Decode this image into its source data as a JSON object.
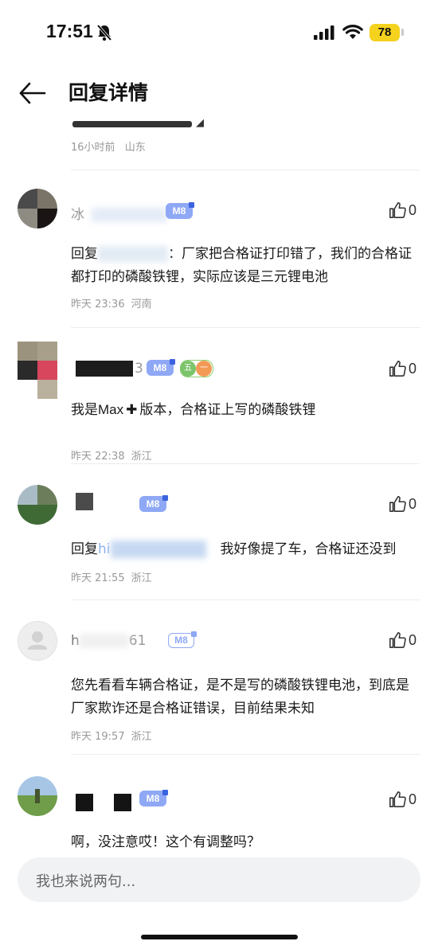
{
  "status_bar": {
    "time": "17:51",
    "battery": "78"
  },
  "header": {
    "title": "回复详情"
  },
  "partial_comment": {
    "time": "16小时前",
    "region": "山东"
  },
  "comments": [
    {
      "name": "冰",
      "badge": "M8",
      "likes": "0",
      "reply_prefix": "回复",
      "text": "：厂家把合格证打印错了，我们的合格证都打印的磷酸铁锂，实际应该是三元锂电池",
      "time": "昨天 23:36",
      "region": "河南"
    },
    {
      "name": "3",
      "badge": "M8",
      "level": "五一",
      "likes": "0",
      "text_a": "我是",
      "text_b": "Max",
      "text_c": "版本，合格证上写的磷酸铁锂",
      "time": "昨天 22:38",
      "region": "浙江"
    },
    {
      "name": "",
      "badge": "M8",
      "likes": "0",
      "reply_prefix": "回复",
      "reply_target": "hi",
      "text": "我好像提了车，合格证还没到",
      "time": "昨天 21:55",
      "region": "浙江"
    },
    {
      "name_a": "h",
      "name_b": "61",
      "badge": "M8",
      "likes": "0",
      "text": "您先看看车辆合格证，是不是写的磷酸铁锂电池，到底是厂家欺诈还是合格证错误，目前结果未知",
      "time": "昨天 19:57",
      "region": "浙江"
    },
    {
      "badge": "M8",
      "likes": "0",
      "text": "啊，没注意哎！这个有调整吗？"
    }
  ],
  "input": {
    "placeholder": "我也来说两句..."
  },
  "icons": [
    "bell-mute-icon",
    "signal-icon",
    "wifi-icon",
    "battery-icon",
    "back-arrow-icon",
    "thumbs-up-icon",
    "default-avatar-icon"
  ],
  "colors": {
    "badge": "#8fa8f5",
    "badge_flag": "#3b63e0",
    "meta": "#999999",
    "level_badge": "#7cc46b"
  }
}
